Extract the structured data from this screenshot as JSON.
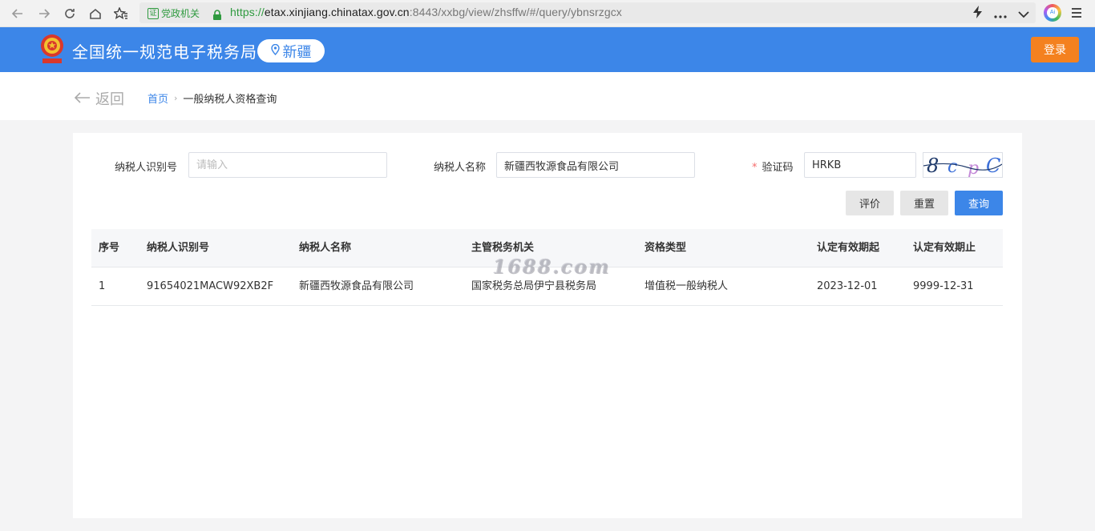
{
  "browser": {
    "cert_label": "党政机关",
    "url_proto": "https://",
    "url_host": "etax.xinjiang.chinatax.gov.cn",
    "url_path": ":8443/xxbg/view/zhsffw/#/query/ybnsrzgcx",
    "profile_label": "Ai"
  },
  "header": {
    "site_title": "全国统一规范电子税务局",
    "region": "新疆",
    "login_label": "登录"
  },
  "breadcrumb": {
    "back_label": "返回",
    "home": "首页",
    "current": "一般纳税人资格查询"
  },
  "form": {
    "taxpayer_id_label": "纳税人识别号",
    "taxpayer_id_placeholder": "请输入",
    "taxpayer_id_value": "",
    "taxpayer_name_label": "纳税人名称",
    "taxpayer_name_value": "新疆西牧源食品有限公司",
    "captcha_required": "*",
    "captcha_label": "验证码",
    "captcha_value": "HRKB",
    "captcha_image_text": "8cpC"
  },
  "actions": {
    "evaluate": "评价",
    "reset": "重置",
    "query": "查询"
  },
  "table": {
    "headers": [
      "序号",
      "纳税人识别号",
      "纳税人名称",
      "主管税务机关",
      "资格类型",
      "认定有效期起",
      "认定有效期止"
    ],
    "rows": [
      [
        "1",
        "91654021MACW92XB2F",
        "新疆西牧源食品有限公司",
        "国家税务总局伊宁县税务局",
        "增值税一般纳税人",
        "2023-12-01",
        "9999-12-31"
      ]
    ]
  },
  "watermark": "1688.com"
}
